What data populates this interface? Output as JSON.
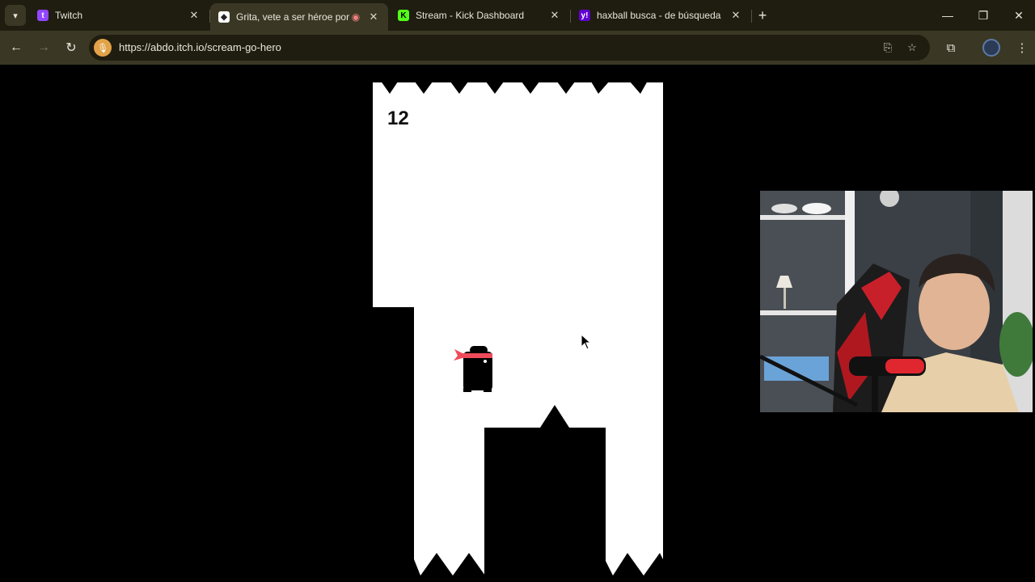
{
  "browser": {
    "tabs": [
      {
        "title": "Twitch",
        "favicon": "twitch-icon",
        "color": "#9146ff",
        "active": false
      },
      {
        "title": "Grita, vete a ser héroe por Abdo",
        "favicon": "itch-icon",
        "color": "#ffffff",
        "active": true,
        "recording": true
      },
      {
        "title": "Stream - Kick Dashboard",
        "favicon": "kick-icon",
        "color": "#53fc18",
        "active": false
      },
      {
        "title": "haxball busca - de búsqueda",
        "favicon": "yahoo-icon",
        "color": "#6001d2",
        "active": false
      }
    ],
    "url": "https://abdo.itch.io/scream-go-hero"
  },
  "game": {
    "score": "12",
    "colors": {
      "wall": "#000000",
      "background": "#ffffff",
      "bandana": "#f04a5a"
    }
  },
  "webcam": {
    "label": "streamer-webcam"
  }
}
